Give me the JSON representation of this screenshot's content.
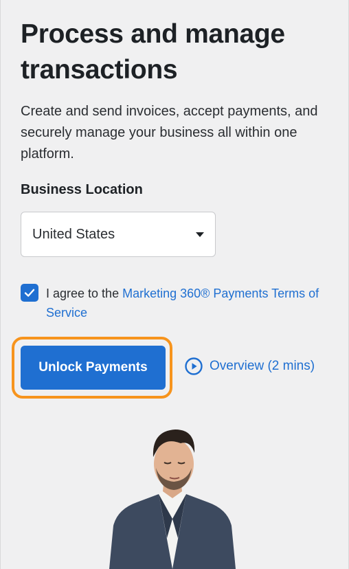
{
  "header": {
    "title": "Process and manage transactions",
    "description": "Create and send invoices, accept payments, and securely manage your business all within one platform."
  },
  "form": {
    "location_label": "Business Location",
    "location_value": "United States",
    "agree_prefix": "I agree to the ",
    "terms_link": "Marketing 360® Payments Terms of Service",
    "checkbox_checked": true
  },
  "actions": {
    "unlock_label": "Unlock Payments",
    "overview_label": "Overview (2 mins)"
  },
  "icons": {
    "checkbox": "check-icon",
    "select": "caret-down-icon",
    "overview": "play-circle-icon"
  },
  "colors": {
    "accent": "#1f6fd1",
    "focus_ring": "#f7941d",
    "background": "#f0f0f1"
  }
}
